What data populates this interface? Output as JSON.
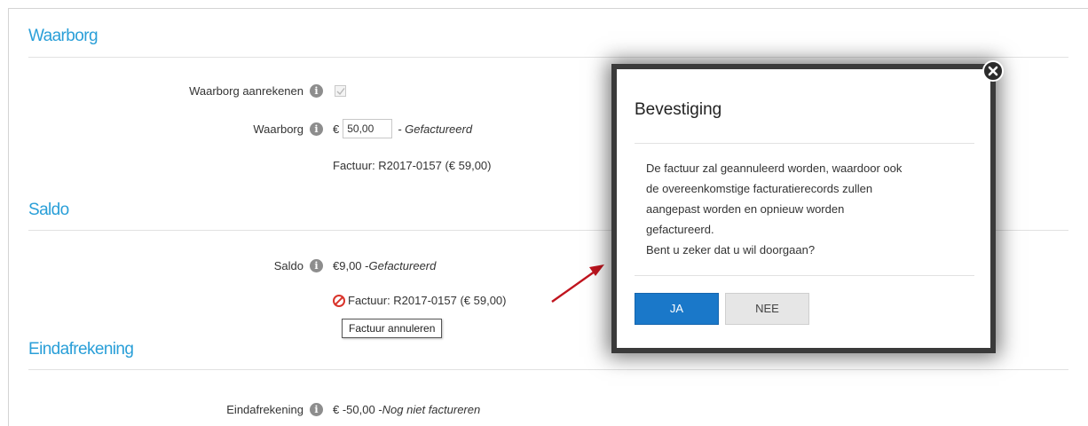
{
  "sections": {
    "waarborg_title": "Waarborg",
    "saldo_title": "Saldo",
    "eind_title": "Eindafrekening"
  },
  "waarborg": {
    "aanrekenen_label": "Waarborg aanrekenen",
    "aanrekenen_checked": true,
    "label": "Waarborg",
    "currency": "€",
    "amount_value": "50,00",
    "status": "- Gefactureerd",
    "invoice": "Factuur: R2017-0157 (€ 59,00)"
  },
  "saldo": {
    "label": "Saldo",
    "amount": "€9,00 - ",
    "status": "Gefactureerd",
    "invoice": "Factuur: R2017-0157 (€ 59,00)",
    "tooltip": "Factuur annuleren"
  },
  "eind": {
    "label": "Eindafrekening",
    "amount": "€ -50,00 - ",
    "status": "Nog niet factureren"
  },
  "dialog": {
    "title": "Bevestiging",
    "message_lines": [
      "De factuur zal geannuleerd worden, waardoor ook",
      "de overeenkomstige facturatierecords zullen",
      "aangepast worden en opnieuw worden",
      "gefactureerd.",
      "Bent u zeker dat u wil doorgaan?"
    ],
    "yes_label": "JA",
    "no_label": "NEE"
  },
  "colors": {
    "accent": "#2a9fd8",
    "primary_button": "#1a78c9",
    "cancel_icon": "#d9342b",
    "arrow": "#c0141e"
  },
  "icons": {
    "info": "info-icon",
    "cancel_invoice": "cancel-icon",
    "close": "close-icon",
    "checkbox": "checkmark-icon"
  }
}
